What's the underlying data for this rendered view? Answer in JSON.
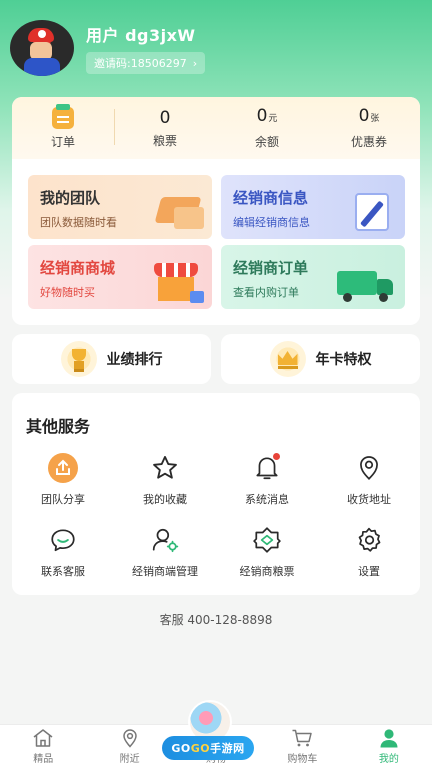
{
  "profile": {
    "username": "用户 dg3jxW",
    "invite_code": "邀请码:18506297",
    "invite_chevron": "›"
  },
  "stats": {
    "order_label": "订单",
    "coupons_food": {
      "value": "0",
      "label": "粮票"
    },
    "balance": {
      "value": "0",
      "unit": "元",
      "label": "余额"
    },
    "vouchers": {
      "value": "0",
      "unit": "张",
      "label": "优惠券"
    }
  },
  "tiles": {
    "team": {
      "title": "我的团队",
      "subtitle": "团队数据随时看"
    },
    "dealer_info": {
      "title": "经销商信息",
      "subtitle": "编辑经销商信息"
    },
    "dealer_mall": {
      "title": "经销商商城",
      "subtitle": "好物随时买"
    },
    "dealer_order": {
      "title": "经销商订单",
      "subtitle": "查看内购订单"
    }
  },
  "quick": {
    "performance_label": "业绩排行",
    "vip_label": "年卡特权"
  },
  "services": {
    "title": "其他服务",
    "items": [
      {
        "label": "团队分享",
        "icon": "share-upload-icon"
      },
      {
        "label": "我的收藏",
        "icon": "star-icon"
      },
      {
        "label": "系统消息",
        "icon": "bell-icon"
      },
      {
        "label": "收货地址",
        "icon": "location-pin-icon"
      },
      {
        "label": "联系客服",
        "icon": "chat-bubble-icon"
      },
      {
        "label": "经销商端管理",
        "icon": "user-manage-icon"
      },
      {
        "label": "经销商粮票",
        "icon": "ticket-icon"
      },
      {
        "label": "设置",
        "icon": "gear-icon"
      }
    ]
  },
  "support_phone": "客服 400-128-8898",
  "tabbar": {
    "items": [
      {
        "label": "精品",
        "icon": "home-icon"
      },
      {
        "label": "附近",
        "icon": "location-icon"
      },
      {
        "label": "购物",
        "icon": "watermark-covered"
      },
      {
        "label": "购物车",
        "icon": "cart-icon"
      },
      {
        "label": "我的",
        "icon": "user-icon"
      }
    ],
    "active_color": "#2fb877"
  },
  "watermark": {
    "text_a": "GO",
    "text_b": "GO",
    "text_c": "手游网"
  },
  "colors": {
    "accent": "#4fcf95",
    "notify_dot": "#e8443a"
  }
}
